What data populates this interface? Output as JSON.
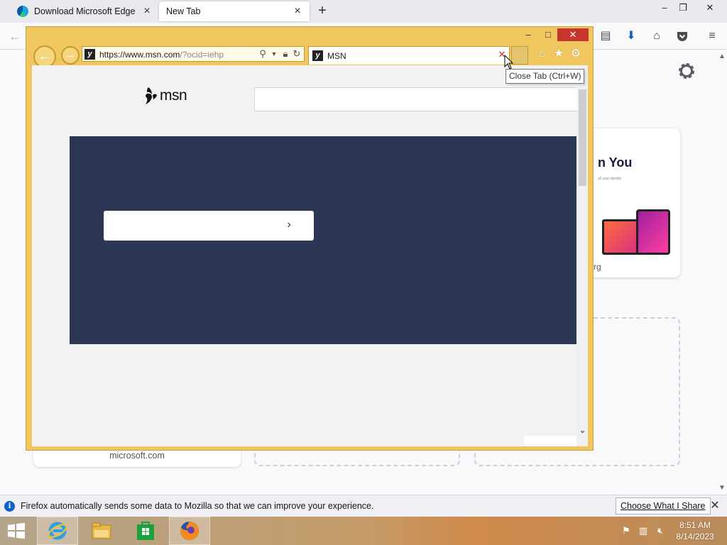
{
  "firefox": {
    "tabs": [
      {
        "label": "Download Microsoft Edge",
        "active": false
      },
      {
        "label": "New Tab",
        "active": true
      }
    ],
    "new_tab_symbol": "+",
    "window_controls": {
      "minimize": "–",
      "restore": "❐",
      "close": "✕"
    },
    "toolbar_icons": [
      "library-icon",
      "download-icon",
      "home-icon",
      "pocket-icon",
      "menu-icon"
    ],
    "content": {
      "card_headline": "n You",
      "card_small_text": "all your identity",
      "card_site": "rg",
      "tile_bottom_site": "microsoft.com"
    },
    "notification": {
      "message": "Firefox automatically sends some data to Mozilla so that we can improve your experience.",
      "button": "Choose What I Share",
      "close": "✕"
    }
  },
  "ie": {
    "window_controls": {
      "minimize": "–",
      "maximize": "□",
      "close": "✕"
    },
    "address": {
      "url_dark": "https://www.",
      "url_host": "msn.com",
      "url_rest": "/?ocid=iehp"
    },
    "tab": {
      "title": "MSN",
      "close": "✕"
    },
    "tooltip": "Close Tab (Ctrl+W)",
    "page": {
      "logo_text": "msn",
      "search_value": "",
      "hero_button_label": "",
      "hero_color": "#2b3754"
    }
  },
  "taskbar": {
    "apps": [
      "internet-explorer",
      "file-explorer",
      "store",
      "firefox"
    ],
    "clock_time": "8:51 AM",
    "clock_date": "8/14/2023"
  },
  "colors": {
    "ie_frame": "#f0c75e",
    "ie_close": "#c7362c",
    "msn_hero": "#2b3754",
    "firefox_accent": "#0a64c8"
  }
}
